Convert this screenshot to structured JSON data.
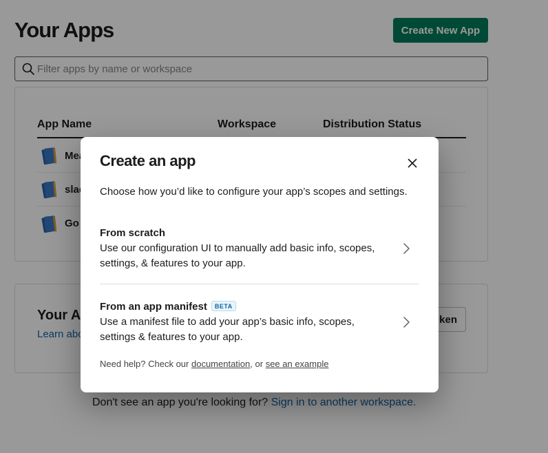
{
  "page": {
    "title": "Your Apps",
    "create_button": "Create New App",
    "filter_placeholder": "Filter apps by name or workspace"
  },
  "apps_table": {
    "columns": [
      "App Name",
      "Workspace",
      "Distribution Status"
    ],
    "rows": [
      {
        "name": "Mea",
        "icon": "app-notebook-icon"
      },
      {
        "name": "slac",
        "icon": "app-notebook-icon"
      },
      {
        "name": "Go",
        "icon": "app-notebook-icon"
      }
    ]
  },
  "tokens_card": {
    "title": "Your Ap",
    "link": "Learn abo",
    "button": "ken"
  },
  "footer": {
    "text": "Don't see an app you're looking for?",
    "link": "Sign in to another workspace."
  },
  "modal": {
    "title": "Create an app",
    "subtitle": "Choose how you’d like to configure your app’s scopes and settings.",
    "options": [
      {
        "title": "From scratch",
        "description": "Use our configuration UI to manually add basic info, scopes, settings, & features to your app.",
        "badge": ""
      },
      {
        "title": "From an app manifest",
        "description": "Use a manifest file to add your app’s basic info, scopes, settings & features to your app.",
        "badge": "BETA"
      }
    ],
    "help": {
      "prefix": "Need help? Check our",
      "doc_link": "documentation",
      "middle": ", or",
      "example_link": "see an example"
    }
  },
  "colors": {
    "primary_button": "#007a5a",
    "link": "#1264a3",
    "text": "#1d1c1d"
  }
}
